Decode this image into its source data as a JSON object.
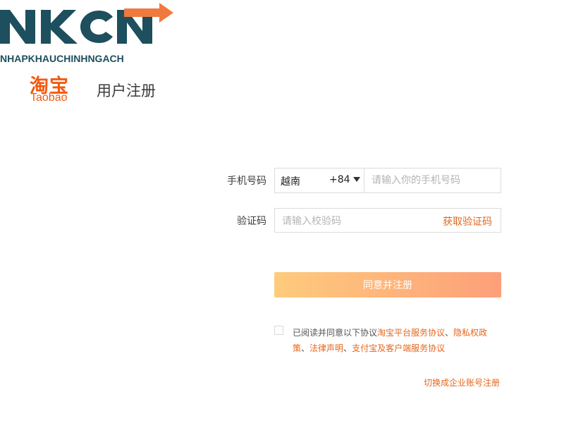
{
  "watermark": {
    "mark": "NKCN",
    "tagline": "NHAPKHAUCHINHNGACH",
    "colors": {
      "dark": "#1d4f5e",
      "arrow": "#f07a3e"
    }
  },
  "logo": {
    "cn": "淘宝",
    "en": "Taobao",
    "color": "#f35a0e"
  },
  "page_title": "用户注册",
  "form": {
    "phone_label": "手机号码",
    "country": "越南",
    "country_code": "+84",
    "phone_placeholder": "请输入你的手机号码",
    "code_label": "验证码",
    "code_placeholder": "请输入校验码",
    "get_code": "获取验证码",
    "submit": "同意并注册"
  },
  "agreement": {
    "prefix": "已阅读并同意以下协议",
    "link_1": "淘宝平台服务协议",
    "sep_1": "、",
    "link_2": "隐私权政策",
    "sep_2": "、",
    "link_3": "法律声明",
    "sep_3": "、",
    "link_4": "支付宝及客户端服务协议"
  },
  "switch_link": "切换成企业账号注册",
  "accent_color": "#e4661c"
}
